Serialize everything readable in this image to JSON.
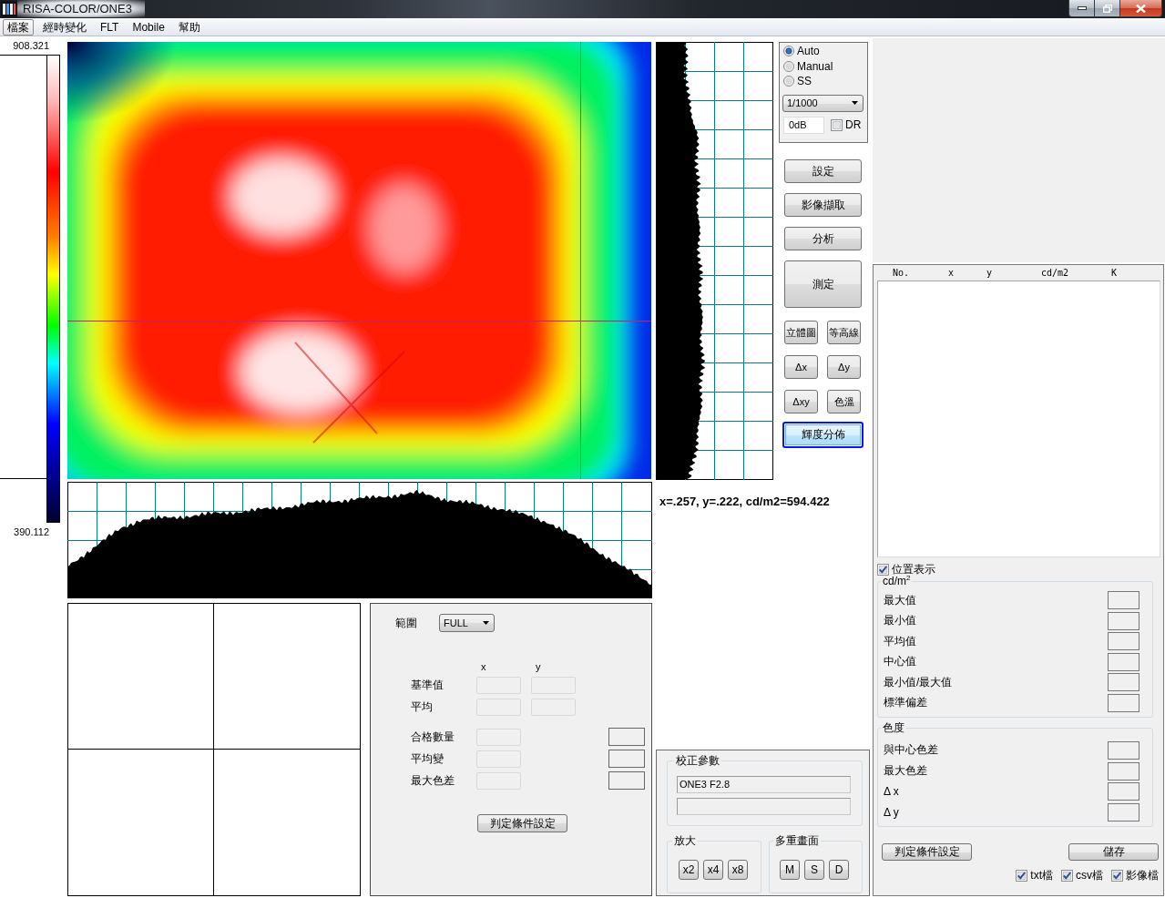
{
  "window": {
    "title": "RISA-COLOR/ONE3"
  },
  "menu": [
    {
      "label": "檔案",
      "selected": true
    },
    {
      "label": "經時變化",
      "selected": false
    },
    {
      "label": "FLT",
      "selected": false
    },
    {
      "label": "Mobile",
      "selected": false
    },
    {
      "label": "幫助",
      "selected": false
    }
  ],
  "color_scale": {
    "max": "908.321",
    "min": "390.112"
  },
  "exposure": {
    "modes": [
      {
        "label": "Auto",
        "selected": true
      },
      {
        "label": "Manual",
        "selected": false
      },
      {
        "label": "SS",
        "selected": false
      }
    ],
    "shutter": "1/1000",
    "gain": "0dB",
    "dr": {
      "label": "DR",
      "checked": false
    }
  },
  "actions": [
    {
      "label": "設定",
      "kind": "normal"
    },
    {
      "label": "影像擷取",
      "kind": "normal"
    },
    {
      "label": "分析",
      "kind": "normal"
    },
    {
      "label": "測定",
      "kind": "tall"
    }
  ],
  "view_buttons": [
    {
      "label": "立體圖",
      "kind": "small",
      "selected": false
    },
    {
      "label": "等高線",
      "kind": "small",
      "selected": false
    },
    {
      "label": "Δx",
      "kind": "small",
      "selected": false
    },
    {
      "label": "Δy",
      "kind": "small",
      "selected": false
    },
    {
      "label": "Δxy",
      "kind": "small",
      "selected": false
    },
    {
      "label": "色溫",
      "kind": "small",
      "selected": false
    },
    {
      "label": "輝度分佈",
      "kind": "wide",
      "selected": true
    }
  ],
  "readout": "x=.257, y=.222, cd/m2=594.422",
  "range_panel": {
    "label": "範圍",
    "range": "FULL",
    "columns": [
      "x",
      "y"
    ],
    "rows": [
      {
        "label": "基準值",
        "kind": "xy"
      },
      {
        "label": "平均",
        "kind": "xy"
      },
      {
        "label": "合格數量",
        "kind": "judge"
      },
      {
        "label": "平均變",
        "kind": "judge"
      },
      {
        "label": "最大色差",
        "kind": "judge"
      }
    ],
    "button": "判定條件設定"
  },
  "calibration": {
    "title": "校正參數",
    "value": "ONE3 F2.8",
    "zoom": {
      "title": "放大",
      "buttons": [
        "x2",
        "x4",
        "x8"
      ]
    },
    "multi_view": {
      "title": "多重畫面",
      "buttons": [
        "M",
        "S",
        "D"
      ]
    }
  },
  "results": {
    "columns": [
      "No.",
      "x",
      "y",
      "cd/m2",
      "K"
    ],
    "show_position": {
      "label": "位置表示",
      "checked": true
    },
    "luminance": {
      "title": "cd/m$^{2}$",
      "rows": [
        "最大值",
        "最小值",
        "平均值",
        "中心值",
        "最小值/最大值",
        "標準偏差"
      ]
    },
    "chromaticity": {
      "title": "色度",
      "rows": [
        "與中心色差",
        "最大色差",
        "Δ x",
        "Δ y"
      ]
    },
    "buttons": [
      "判定條件設定",
      "儲存"
    ],
    "export": [
      {
        "label": "txt檔",
        "checked": true
      },
      {
        "label": "csv檔",
        "checked": true
      },
      {
        "label": "影像檔",
        "checked": true
      }
    ]
  }
}
